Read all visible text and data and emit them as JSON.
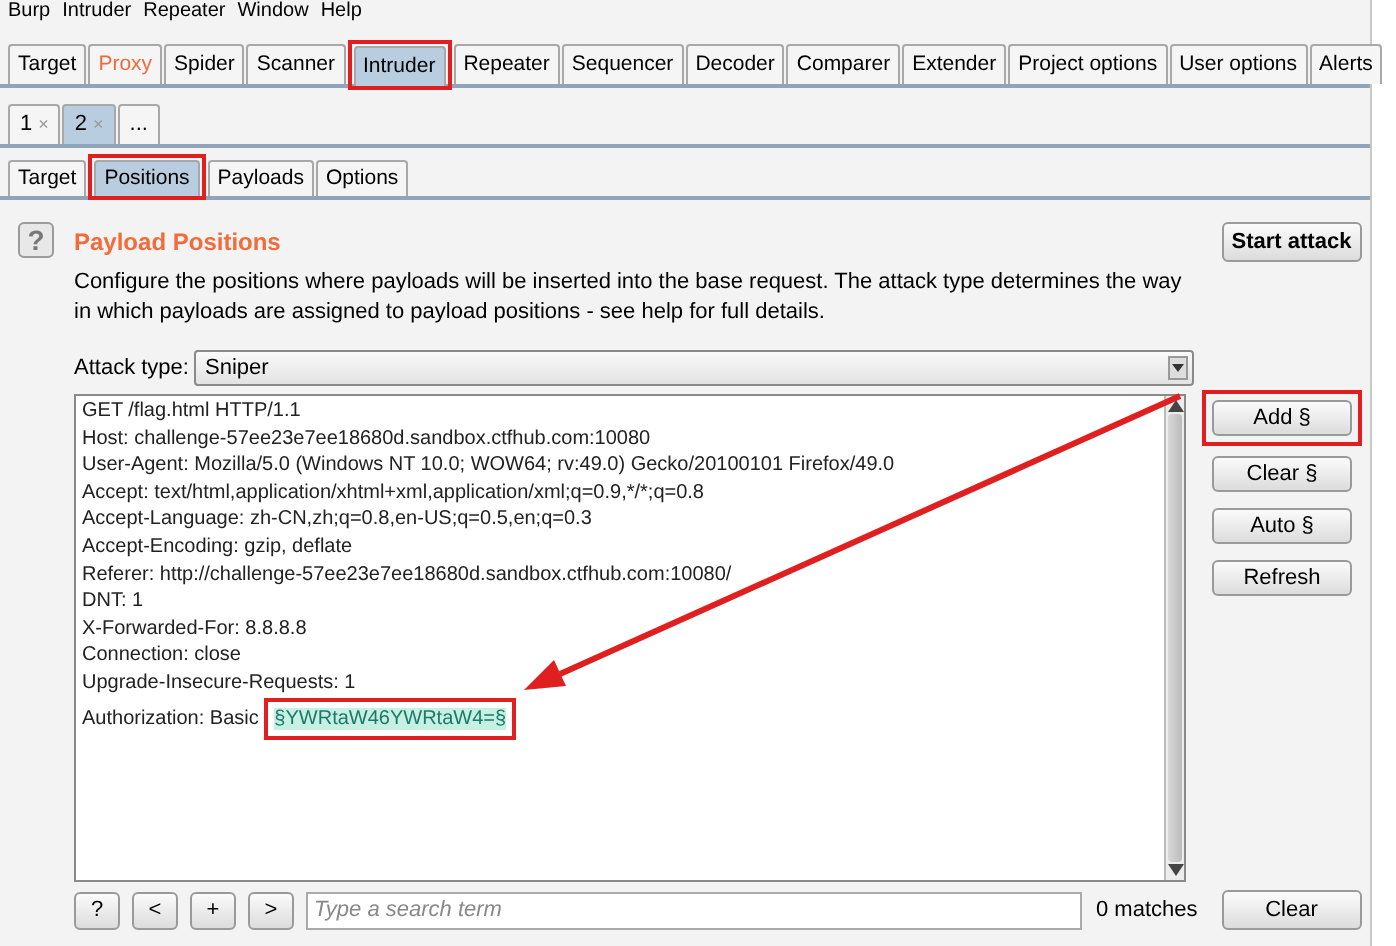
{
  "menu": [
    "Burp",
    "Intruder",
    "Repeater",
    "Window",
    "Help"
  ],
  "main_tabs": [
    {
      "label": "Target",
      "selected": false,
      "highlighted": false
    },
    {
      "label": "Proxy",
      "selected": false,
      "highlighted": true
    },
    {
      "label": "Spider",
      "selected": false,
      "highlighted": false
    },
    {
      "label": "Scanner",
      "selected": false,
      "highlighted": false
    },
    {
      "label": "Intruder",
      "selected": true,
      "highlighted": false
    },
    {
      "label": "Repeater",
      "selected": false,
      "highlighted": false
    },
    {
      "label": "Sequencer",
      "selected": false,
      "highlighted": false
    },
    {
      "label": "Decoder",
      "selected": false,
      "highlighted": false
    },
    {
      "label": "Comparer",
      "selected": false,
      "highlighted": false
    },
    {
      "label": "Extender",
      "selected": false,
      "highlighted": false
    },
    {
      "label": "Project options",
      "selected": false,
      "highlighted": false
    },
    {
      "label": "User options",
      "selected": false,
      "highlighted": false
    },
    {
      "label": "Alerts",
      "selected": false,
      "highlighted": false
    }
  ],
  "attack_tabs": [
    {
      "label": "1",
      "close": "×",
      "selected": false
    },
    {
      "label": "2",
      "close": "×",
      "selected": true
    },
    {
      "label": "...",
      "selected": false
    }
  ],
  "sub_tabs": [
    {
      "label": "Target",
      "selected": false
    },
    {
      "label": "Positions",
      "selected": true
    },
    {
      "label": "Payloads",
      "selected": false
    },
    {
      "label": "Options",
      "selected": false
    }
  ],
  "help_icon": "?",
  "title": "Payload Positions",
  "description": "Configure the positions where payloads will be inserted into the base request. The attack type determines the way in which payloads are assigned to payload positions - see help for full details.",
  "start_button": "Start attack",
  "attack_type": {
    "label": "Attack type:",
    "value": "Sniper"
  },
  "request_lines": [
    {
      "text": "GET /flag.html HTTP/1.1"
    },
    {
      "text": "Host: challenge-57ee23e7ee18680d.sandbox.ctfhub.com:10080"
    },
    {
      "text": "User-Agent: Mozilla/5.0 (Windows NT 10.0; WOW64; rv:49.0) Gecko/20100101 Firefox/49.0"
    },
    {
      "text": "Accept: text/html,application/xhtml+xml,application/xml;q=0.9,*/*;q=0.8"
    },
    {
      "text": "Accept-Language: zh-CN,zh;q=0.8,en-US;q=0.5,en;q=0.3"
    },
    {
      "text": "Accept-Encoding: gzip, deflate"
    },
    {
      "text": "Referer: http://challenge-57ee23e7ee18680d.sandbox.ctfhub.com:10080/"
    },
    {
      "text": "DNT: 1"
    },
    {
      "text": "X-Forwarded-For: 8.8.8.8"
    },
    {
      "text": "Connection: close"
    },
    {
      "text": "Upgrade-Insecure-Requests: 1"
    },
    {
      "text": "Authorization: Basic ",
      "payload": "§YWRtaW46YWRtaW4=§"
    }
  ],
  "side_buttons": [
    "Add §",
    "Clear §",
    "Auto §",
    "Refresh"
  ],
  "search_bar": {
    "buttons": [
      "?",
      "<",
      "+",
      ">"
    ],
    "placeholder": "Type a search term",
    "matches": "0 matches",
    "clear": "Clear"
  }
}
